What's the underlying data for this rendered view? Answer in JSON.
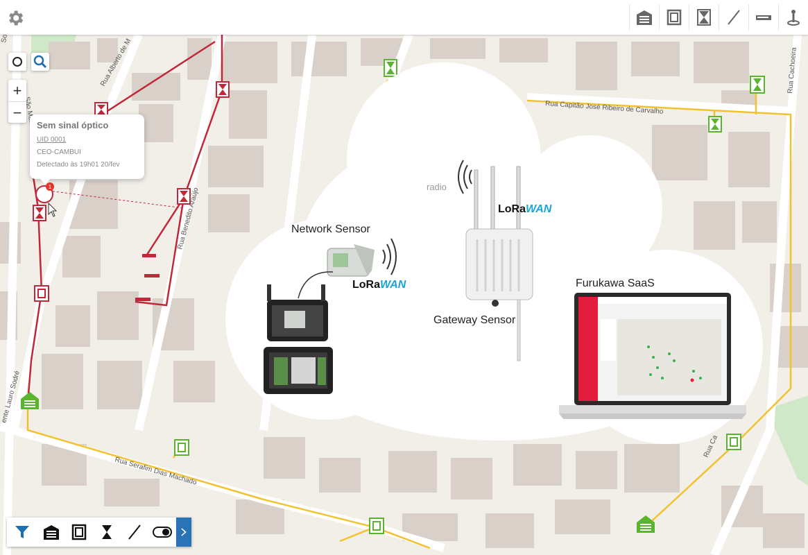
{
  "app": {
    "title": ""
  },
  "toolbar": {
    "items": [
      {
        "name": "cabinet-icon"
      },
      {
        "name": "box-icon"
      },
      {
        "name": "splice-icon"
      },
      {
        "name": "cable-icon"
      },
      {
        "name": "splitter-icon"
      },
      {
        "name": "pole-icon"
      }
    ]
  },
  "map_controls": {
    "zoom_in": "+",
    "zoom_out": "−"
  },
  "popup": {
    "title": "Sem sinal óptico",
    "uid": "UID 0001",
    "ceo": "CEO-CAMBUI",
    "detected": "Detectado às 19h01 20/fev",
    "badge": "1"
  },
  "streets": [
    "Rua Alberto de M",
    "São Mateu",
    "Rua Benedito Araújo",
    "Rua Capitão José Ribeiro de Carvalho",
    "Rua Cachoeira",
    "Rua Serafim Dias Machado",
    "Rua Ca",
    "ente Lauro Sodré",
    "Sodré"
  ],
  "diagram": {
    "network_sensor": "Network Sensor",
    "gateway_sensor": "Gateway Sensor",
    "saas": "Furukawa SaaS",
    "radio": "radio",
    "lora_a": "LoRa",
    "lora_b": "WAN"
  },
  "colors": {
    "route": "#c0283a",
    "fiber": "#f2c12e",
    "green": "#5ab52e",
    "accent": "#2a73b6"
  }
}
